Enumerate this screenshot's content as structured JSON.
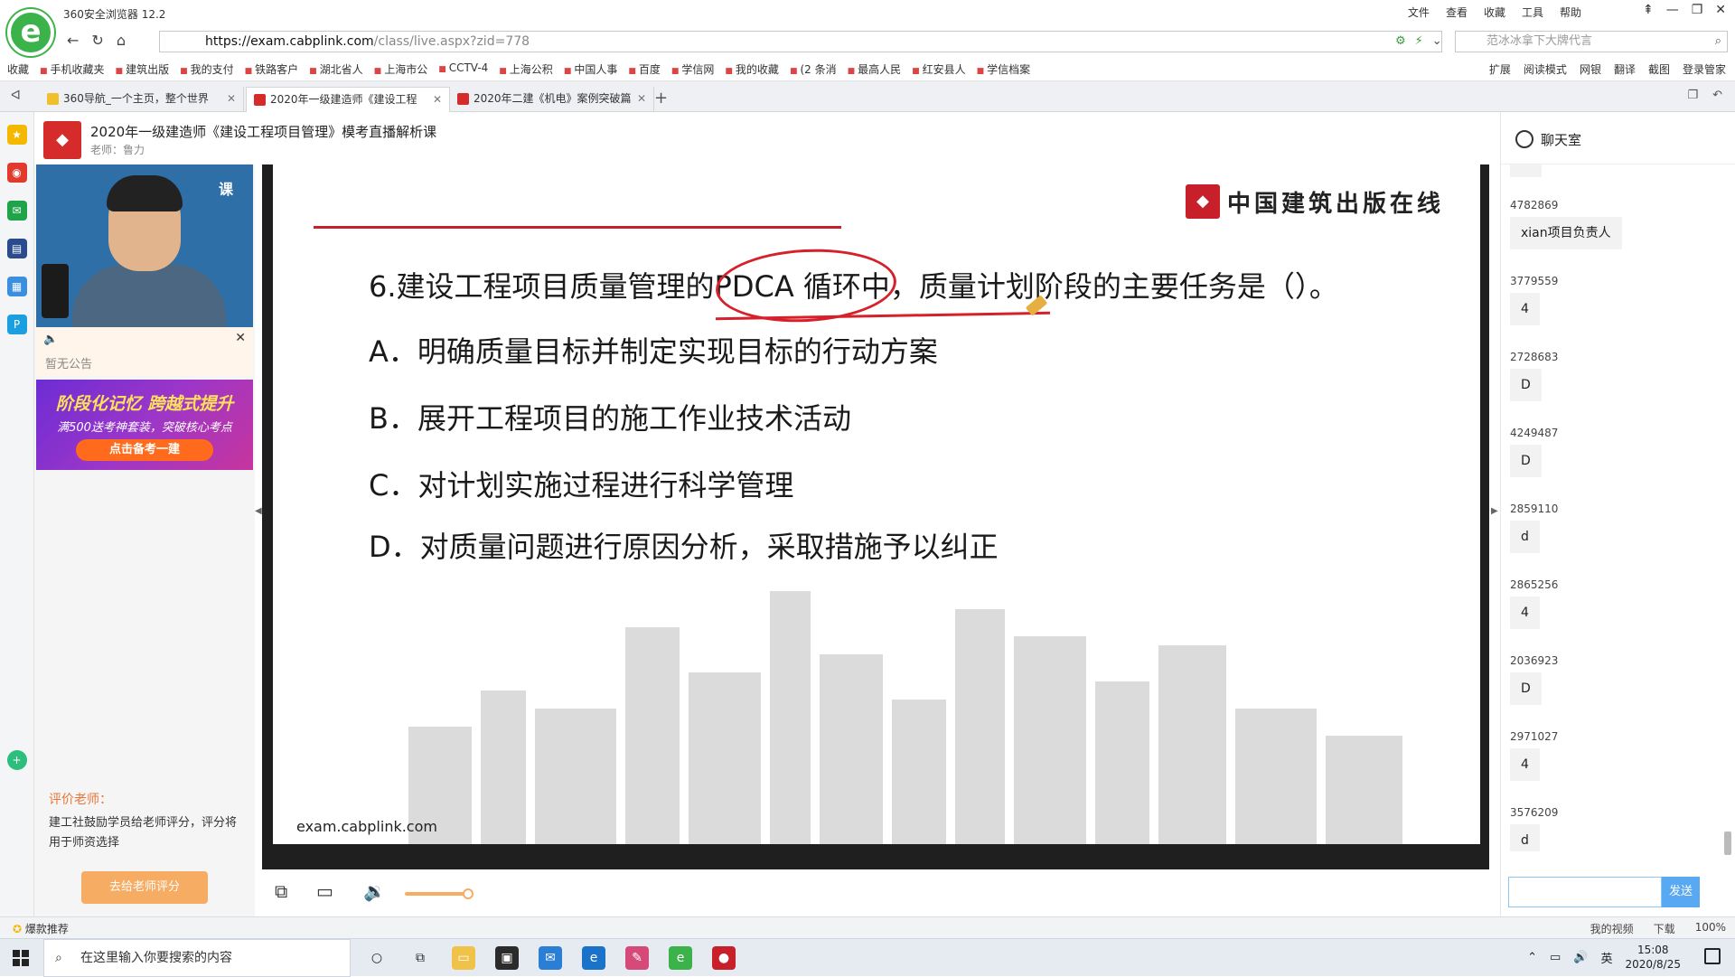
{
  "browser": {
    "name": "360安全浏览器 12.2",
    "menu": [
      "文件",
      "查看",
      "收藏",
      "工具",
      "帮助"
    ],
    "url_host": "https://exam.cabplink.com",
    "url_path": "/class/live.aspx?zid=778",
    "search_placeholder": "范冰冰拿下大牌代言",
    "bookmarks": [
      "收藏",
      "手机收藏夹",
      "建筑出版",
      "我的支付",
      "铁路客户",
      "湖北省人",
      "上海市公",
      "CCTV-4",
      "上海公积",
      "中国人事",
      "百度",
      "学信网",
      "我的收藏",
      "(2 条消",
      "最高人民",
      "红安县人",
      "学信档案"
    ],
    "bookmarks_right": [
      "扩展",
      "阅读模式",
      "网银",
      "翻译",
      "截图",
      "登录管家"
    ],
    "tabs": [
      {
        "title": "360导航_一个主页，整个世界"
      },
      {
        "title": "2020年一级建造师《建设工程"
      },
      {
        "title": "2020年二建《机电》案例突破篇"
      }
    ]
  },
  "course": {
    "title": "2020年一级建造师《建设工程项目管理》模考直播解析课",
    "teacher": "老师：鲁力"
  },
  "left_panel": {
    "video_label": "课",
    "notice_text": "暂无公告",
    "promo_line1": "阶段化记忆 跨越式提升",
    "promo_line2": "满500送考神套装，突破核心考点",
    "promo_button": "点击备考一建",
    "rate_title": "评价老师：",
    "rate_desc": "建工社鼓励学员给老师评分，评分将用于师资选择",
    "rate_button": "去给老师评分"
  },
  "slide": {
    "brand": "中国建筑出版在线",
    "question": "6.建设工程项目质量管理的PDCA 循环中，质量计划阶段的主要任务是（）。",
    "options": [
      "A．明确质量目标并制定实现目标的行动方案",
      "B．展开工程项目的施工作业技术活动",
      "C．对计划实施过程进行科学管理",
      "D．对质量问题进行原因分析，采取措施予以纠正"
    ],
    "source": "exam.cabplink.com"
  },
  "chat": {
    "title": "聊天室",
    "messages": [
      {
        "uid": "4782869",
        "text": "xian项目负责人"
      },
      {
        "uid": "3779559",
        "text": "4"
      },
      {
        "uid": "2728683",
        "text": "D"
      },
      {
        "uid": "4249487",
        "text": "D"
      },
      {
        "uid": "2859110",
        "text": "d"
      },
      {
        "uid": "2865256",
        "text": "4"
      },
      {
        "uid": "2036923",
        "text": "D"
      },
      {
        "uid": "2971027",
        "text": "4"
      },
      {
        "uid": "3576209",
        "text": "d"
      }
    ],
    "send_label": "发送"
  },
  "statusbar": {
    "left": "爆款推荐",
    "right": [
      "我的视频",
      "下载",
      "100%"
    ]
  },
  "taskbar": {
    "search_placeholder": "在这里输入你要搜索的内容",
    "ime": "英",
    "time": "15:08",
    "date": "2020/8/25"
  }
}
